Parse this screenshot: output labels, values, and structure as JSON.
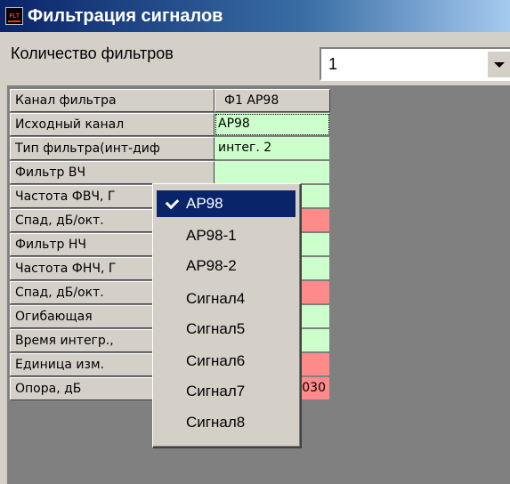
{
  "window": {
    "title": "Фильтрация сигналов",
    "icon": "flt-app-icon",
    "icon_text": "FLT"
  },
  "filter_count": {
    "label": "Количество фильтров",
    "value": "1"
  },
  "grid": {
    "rows": [
      {
        "name": "Канал фильтра",
        "value": "Ф1 АР98",
        "style": "header"
      },
      {
        "name": "Исходный канал",
        "value": "АР98",
        "style": "green-focused"
      },
      {
        "name": "Тип фильтра(инт-диф",
        "value": "интег. 2",
        "style": "green"
      },
      {
        "name": "Фильтр ВЧ",
        "value": "",
        "style": "green"
      },
      {
        "name": "Частота ФВЧ, Г",
        "value": "",
        "style": "green"
      },
      {
        "name": "Спад, дБ/окт.",
        "value": "",
        "style": "red"
      },
      {
        "name": "Фильтр НЧ",
        "value": "",
        "style": "green"
      },
      {
        "name": "Частота ФНЧ, Г",
        "value": "",
        "style": "green"
      },
      {
        "name": "Спад, дБ/окт.",
        "value": "",
        "style": "red"
      },
      {
        "name": "Огибающая",
        "value": "",
        "style": "green"
      },
      {
        "name": "Время интегр.,",
        "value": "",
        "style": "green"
      },
      {
        "name": "Единица изм.",
        "value": "",
        "style": "red"
      },
      {
        "name": "Опора, дБ",
        "value": "0.000030",
        "style": "red-right"
      }
    ]
  },
  "dropdown": {
    "items": [
      {
        "label": "АР98",
        "selected": true
      },
      {
        "label": "АР98-1",
        "selected": false
      },
      {
        "label": "АР98-2",
        "selected": false
      },
      {
        "label": "Сигнал4",
        "selected": false
      },
      {
        "label": "Сигнал5",
        "selected": false
      },
      {
        "label": "Сигнал6",
        "selected": false
      },
      {
        "label": "Сигнал7",
        "selected": false
      },
      {
        "label": "Сигнал8",
        "selected": false
      }
    ]
  },
  "colors": {
    "titlebar_start": "#0a246a",
    "titlebar_end": "#a6caf0",
    "cell_green": "#ccffcc",
    "cell_red": "#ff8a8a",
    "selection": "#0a246a",
    "face": "#d4d0c8"
  }
}
